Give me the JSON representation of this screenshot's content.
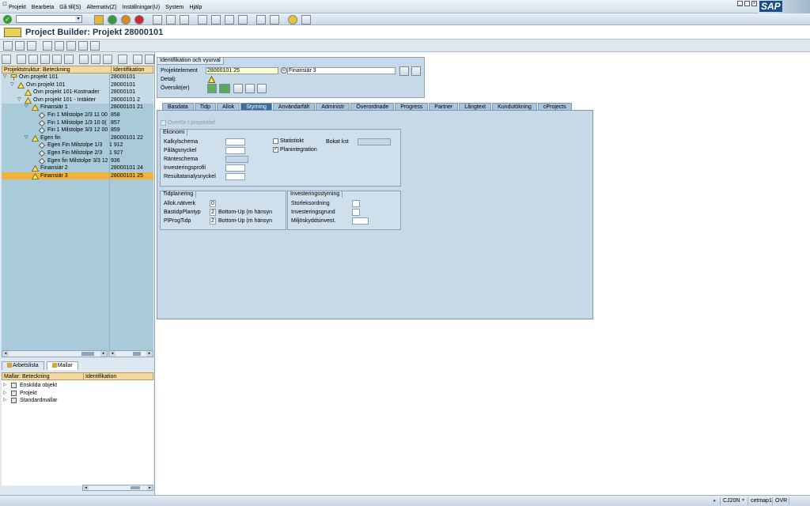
{
  "menu": {
    "items": [
      "Projekt",
      "Bearbeta",
      "Gå till(S)",
      "Alternativ(Z)",
      "Inställningar(U)",
      "System",
      "Hjälp"
    ],
    "logo": "SAP"
  },
  "title": "Project Builder: Projekt 28000101",
  "tree": {
    "col1": "Projektstruktur: Beteckning",
    "col2": "Identifikation",
    "rows": [
      {
        "label": "Övn projekt 101",
        "id": "28000101",
        "indent": 0,
        "icon": "project-icon",
        "expand": "open"
      },
      {
        "label": "Övn projekt 101",
        "id": "28000101",
        "indent": 1,
        "icon": "wbs-icon",
        "expand": "open"
      },
      {
        "label": "Övn projekt 101-Kostnader",
        "id": "28000101",
        "indent": 2,
        "icon": "wbs-icon",
        "expand": ""
      },
      {
        "label": "Övn projekt 101 - Intäkter",
        "id": "28000101 2",
        "indent": 2,
        "icon": "wbs-icon",
        "expand": "open"
      },
      {
        "label": "Finansiär 1",
        "id": "28000101 21",
        "indent": 3,
        "icon": "wbs-icon",
        "expand": "open"
      },
      {
        "label": "Fin 1 Milstolpe 2/3 11 00",
        "id": "858",
        "indent": 4,
        "icon": "milestone-icon",
        "expand": ""
      },
      {
        "label": "Fin 1 Milstolpe 1/3  10 0(",
        "id": "857",
        "indent": 4,
        "icon": "milestone-icon",
        "expand": ""
      },
      {
        "label": "Fin 1 Milstolpe 3/3 12 00",
        "id": "859",
        "indent": 4,
        "icon": "milestone-icon",
        "expand": ""
      },
      {
        "label": "Egen fin",
        "id": "28000101 22",
        "indent": 3,
        "icon": "wbs-icon",
        "expand": "open"
      },
      {
        "label": "Egen Fin Milstolpe 1/3",
        "id": "1 912",
        "indent": 4,
        "icon": "milestone-icon",
        "expand": ""
      },
      {
        "label": "Egen Fin Milstolpe 2/3",
        "id": "1 927",
        "indent": 4,
        "icon": "milestone-icon",
        "expand": ""
      },
      {
        "label": "Egen fin Milstolpe 3/3 12",
        "id": "936",
        "indent": 4,
        "icon": "milestone-icon",
        "expand": ""
      },
      {
        "label": "Finansiär 2",
        "id": "28000101 24",
        "indent": 3,
        "icon": "wbs-icon",
        "expand": ""
      },
      {
        "label": "Finansiär 3",
        "id": "28000101 25",
        "indent": 3,
        "icon": "wbs-icon",
        "expand": "",
        "selected": true
      }
    ]
  },
  "worklist_tabs": [
    "Arbetslista",
    "Mallar"
  ],
  "templates": {
    "col1": "Mallar: Beteckning",
    "col2": "Identifikation",
    "rows": [
      "Enskilda objekt",
      "Projekt",
      "Standardmallar"
    ]
  },
  "ident": {
    "title": "Identifikation och vyurval",
    "element_label": "Projektelement",
    "element_value": "28000101 25",
    "element_desc": "Finansiär 3",
    "detail_label": "Detalj:",
    "overview_label": "Översikt(er)"
  },
  "tabs": [
    "Basdata",
    "Tidp",
    "Allok",
    "Styrning",
    "Användarfält",
    "Administr",
    "Överordnade",
    "Progress",
    "Partner",
    "Långtext",
    "Kundutökning",
    "cProjects"
  ],
  "active_tab": "Styrning",
  "content": {
    "transfer_label": "Överför t projektdef",
    "ekonomi": {
      "title": "Ekonomi",
      "fields": [
        "Kalkylschema",
        "Pålägsnyckel",
        "Ränteschema",
        "Investeringsprofil",
        "Resultatanalysnyckel"
      ],
      "statistical_label": "Statistiskt",
      "booked_label": "Bokat kst",
      "planint_label": "Planintegration",
      "statistical_checked": false,
      "planint_checked": true
    },
    "tidplanering": {
      "title": "Tidplanering",
      "rows": [
        {
          "label": "Allok.nätverk",
          "value": "0",
          "text": ""
        },
        {
          "label": "BastidpPlantyp",
          "value": "2",
          "text": "Bottom-Up (m hänsyn"
        },
        {
          "label": "PlProgTidp",
          "value": "2",
          "text": "Bottom-Up (m hänsyn"
        }
      ]
    },
    "investering": {
      "title": "Investeringsstyrning",
      "fields": [
        "Storleksordning",
        "Investeringsgrund",
        "Miljöskyddsinvest."
      ]
    }
  },
  "status": {
    "tcode": "CJ20N",
    "server": "cetmap1",
    "mode": "OVR"
  },
  "colors": {
    "bg_panel": "#c5d9e8",
    "tree_bg": "#d6e6f2",
    "header_blue": "#dde8f1",
    "active_tab": "#3b6d9c",
    "selected_row": "#f2b33d",
    "title_bar": "#ffffff"
  }
}
